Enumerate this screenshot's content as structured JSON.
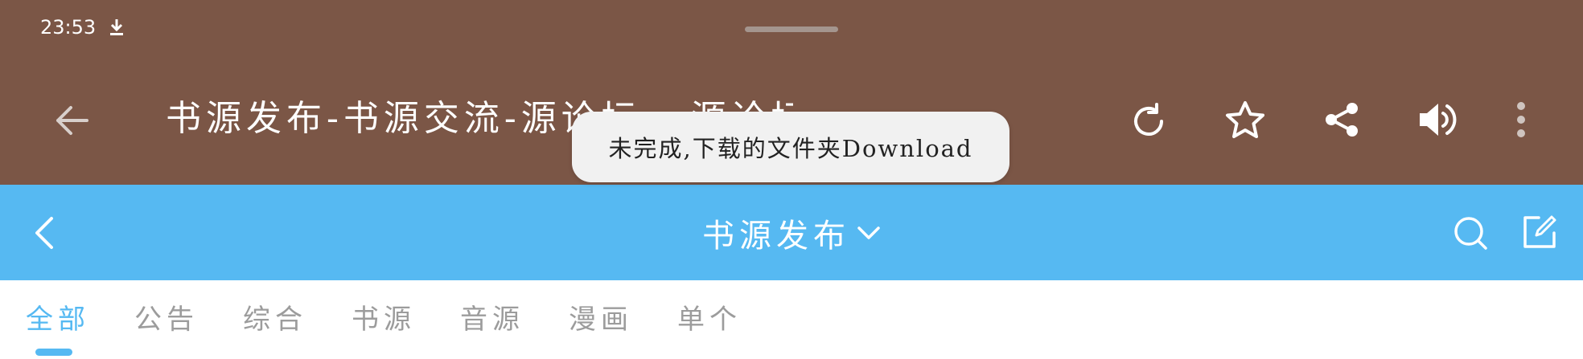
{
  "status_bar": {
    "time": "23:53",
    "download_icon": "download-icon"
  },
  "browser_toolbar": {
    "title": "书源发布-书源交流-源论坛 - 源论坛",
    "icons": {
      "back": "arrow-left-icon",
      "refresh": "refresh-icon",
      "favorite": "star-icon",
      "share": "share-icon",
      "read_aloud": "speaker-icon",
      "more": "more-vertical-icon"
    }
  },
  "toast": {
    "message": "未完成,下载的文件夹Download"
  },
  "forum_header": {
    "title": "书源发布",
    "icons": {
      "back": "chevron-left-icon",
      "dropdown": "chevron-down-icon",
      "search": "search-icon",
      "compose": "compose-icon"
    }
  },
  "tabs": {
    "active_index": 0,
    "items": [
      {
        "label": "全部"
      },
      {
        "label": "公告"
      },
      {
        "label": "综合"
      },
      {
        "label": "书源"
      },
      {
        "label": "音源"
      },
      {
        "label": "漫画"
      },
      {
        "label": "单个"
      }
    ]
  },
  "colors": {
    "toolbar_bg": "#7b5646",
    "forum_header_bg": "#56b9f2",
    "tab_active": "#56b9f2",
    "tab_inactive": "#9c9c9c",
    "toast_bg": "#f1f1f1"
  }
}
